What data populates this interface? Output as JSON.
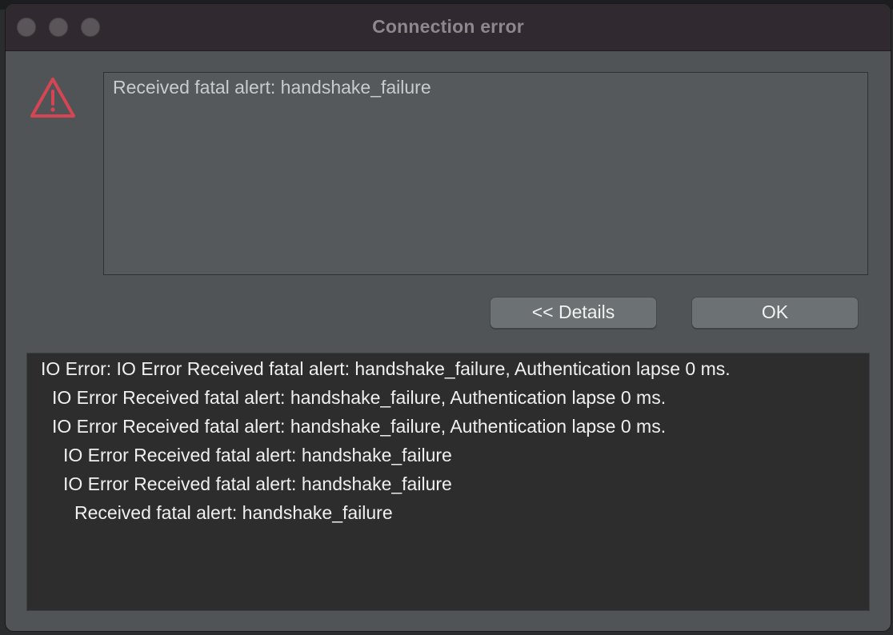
{
  "window": {
    "title": "Connection error"
  },
  "icons": {
    "warning": "warning-triangle-icon"
  },
  "colors": {
    "warning_icon": "#d64553"
  },
  "message": {
    "text": "Received fatal alert: handshake_failure"
  },
  "buttons": {
    "details_label": "<< Details",
    "ok_label": "OK"
  },
  "details": {
    "lines": [
      "IO Error: IO Error Received fatal alert: handshake_failure, Authentication lapse 0 ms.",
      "IO Error Received fatal alert: handshake_failure, Authentication lapse 0 ms.",
      "IO Error Received fatal alert: handshake_failure, Authentication lapse 0 ms.",
      "IO Error Received fatal alert: handshake_failure",
      "IO Error Received fatal alert: handshake_failure",
      "Received fatal alert: handshake_failure"
    ]
  }
}
